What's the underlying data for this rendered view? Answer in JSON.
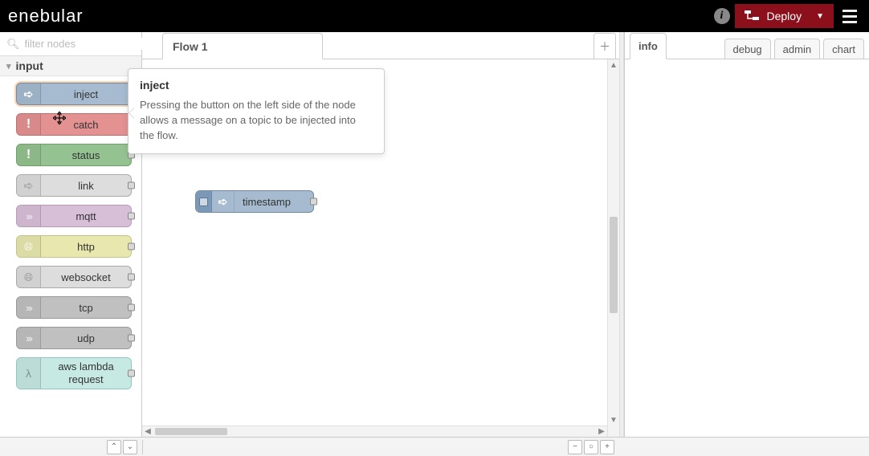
{
  "header": {
    "logo": "enebular",
    "deploy_label": "Deploy"
  },
  "palette": {
    "search_placeholder": "filter nodes",
    "category_label": "input",
    "nodes": {
      "inject": "inject",
      "catch": "catch",
      "status": "status",
      "link": "link",
      "mqtt": "mqtt",
      "http": "http",
      "websocket": "websocket",
      "tcp": "tcp",
      "udp": "udp",
      "aws": "aws lambda request"
    }
  },
  "workspace": {
    "tab_label": "Flow 1",
    "node_label": "timestamp"
  },
  "popover": {
    "title": "inject",
    "body": "Pressing the button on the left side of the node allows a message on a topic to be injected into the flow."
  },
  "sidebar": {
    "tabs": {
      "info": "info",
      "debug": "debug",
      "admin": "admin",
      "chart": "chart"
    }
  },
  "footer": {
    "collapse_up": "⌃",
    "collapse_down": "⌄",
    "zoom_out": "−",
    "zoom_reset": "○",
    "zoom_in": "+"
  }
}
